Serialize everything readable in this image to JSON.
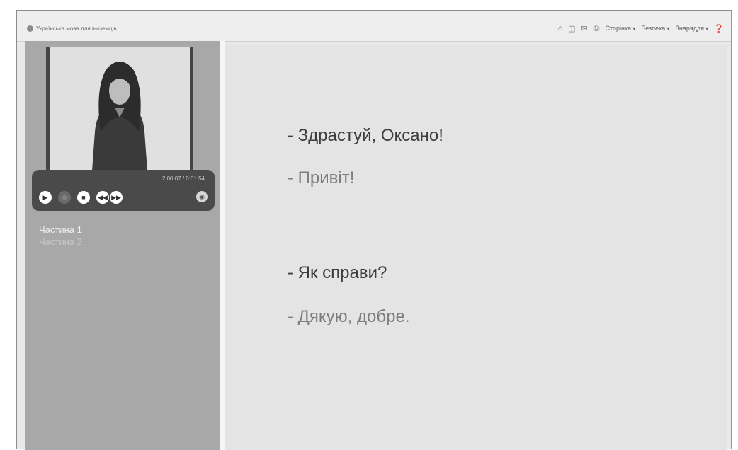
{
  "window": {
    "tab_title": "Українська мова для іноземців"
  },
  "toolbar": {
    "home_icon": "home-icon",
    "feeds_icon": "rss-icon",
    "print_icon": "print-icon",
    "page_menu": "Сторінка",
    "safety_menu": "Безпека",
    "tools_menu": "Знаряддя",
    "help_icon": "help-icon"
  },
  "player": {
    "time": "2:00:07 / 0:01:54",
    "buttons": [
      "play",
      "fullscreen",
      "stop",
      "prev",
      "next"
    ]
  },
  "playlist": {
    "items": [
      "Частина 1",
      "Частина 2"
    ]
  },
  "dialogue": {
    "line1": "- Здрастуй, Оксано!",
    "line2": "- Привіт!",
    "line3": "- Як справи?",
    "line4": "- Дякую, добре."
  }
}
